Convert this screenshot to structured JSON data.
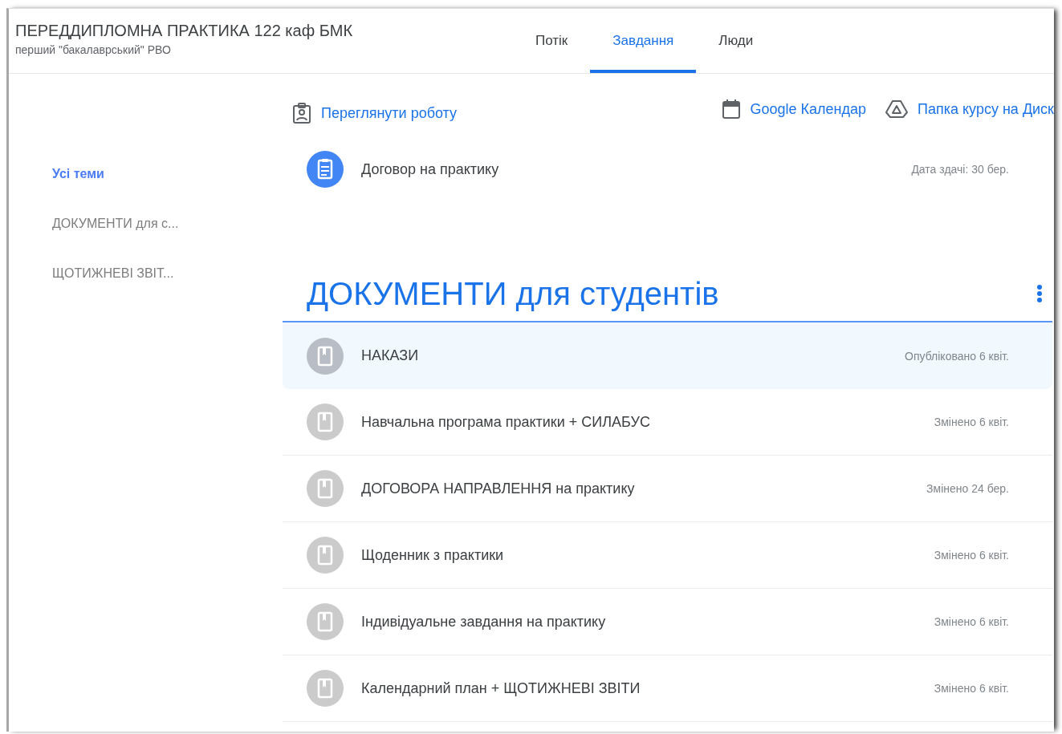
{
  "course": {
    "title": "ПЕРЕДДИПЛОМНА ПРАКТИКА 122 каф БМК",
    "subtitle": "перший \"бакалаврський\" РВО"
  },
  "tabs": [
    {
      "label": "Потік",
      "selected": false
    },
    {
      "label": "Завдання",
      "selected": true
    },
    {
      "label": "Люди",
      "selected": false
    }
  ],
  "sidebar": {
    "topics": [
      {
        "label": "Усі теми",
        "selected": true
      },
      {
        "label": "ДОКУМЕНТИ для с...",
        "selected": false
      },
      {
        "label": "ЩОТИЖНЕВІ ЗВІТ...",
        "selected": false
      }
    ]
  },
  "toolbar": {
    "links": [
      {
        "kind": "work",
        "label": "Переглянути роботу"
      },
      {
        "kind": "calendar",
        "label": "Google Календар"
      },
      {
        "kind": "drive",
        "label": "Папка курсу на Диск"
      }
    ]
  },
  "assignments": [
    {
      "title": "Договор на практику",
      "date": "Дата здачі: 30 бер."
    }
  ],
  "topic": {
    "title": "ДОКУМЕНТИ для студентів",
    "materials": [
      {
        "title": "НАКАЗИ",
        "date": "Опубліковано 6 квіт.",
        "selected": true
      },
      {
        "title": "Навчальна програма практики + СИЛАБУС",
        "date": "Змінено 6 квіт.",
        "selected": false
      },
      {
        "title": "ДОГОВОРА НАПРАВЛЕННЯ на практику",
        "date": "Змінено 24 бер.",
        "selected": false
      },
      {
        "title": "Щоденник з практики",
        "date": "Змінено 6 квіт.",
        "selected": false
      },
      {
        "title": "Індивідуальне завдання на практику",
        "date": "Змінено 6 квіт.",
        "selected": false
      },
      {
        "title": "Календарний план + ЩОТИЖНЕВІ ЗВІТИ",
        "date": "Змінено 6 квіт.",
        "selected": false
      }
    ]
  }
}
